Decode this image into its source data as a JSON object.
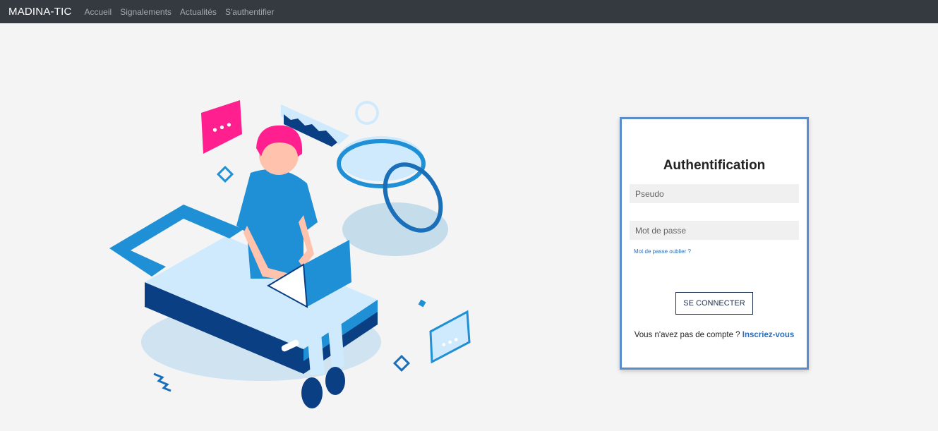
{
  "navbar": {
    "brand": "MADINA-TIC",
    "links": [
      "Accueil",
      "Signalements",
      "Actualités",
      "S'authentifier"
    ]
  },
  "illustration": {
    "bubble_left_text": "•••",
    "bubble_right_text": "•••"
  },
  "login": {
    "title": "Authentification",
    "username_placeholder": "Pseudo",
    "password_placeholder": "Mot de passe",
    "forgot_link": "Mot de passe oublier ?",
    "submit_label": "SE CONNECTER",
    "signup_text": "Vous n'avez pas de compte ?",
    "signup_link": "Inscriez-vous"
  },
  "colors": {
    "navbar_bg": "#343a40",
    "page_bg": "#f4f4f4",
    "card_border": "#5a8ecb",
    "link": "#2a6ebb",
    "accent_pink": "#ff1f8e",
    "accent_blue": "#1f8fd6"
  }
}
